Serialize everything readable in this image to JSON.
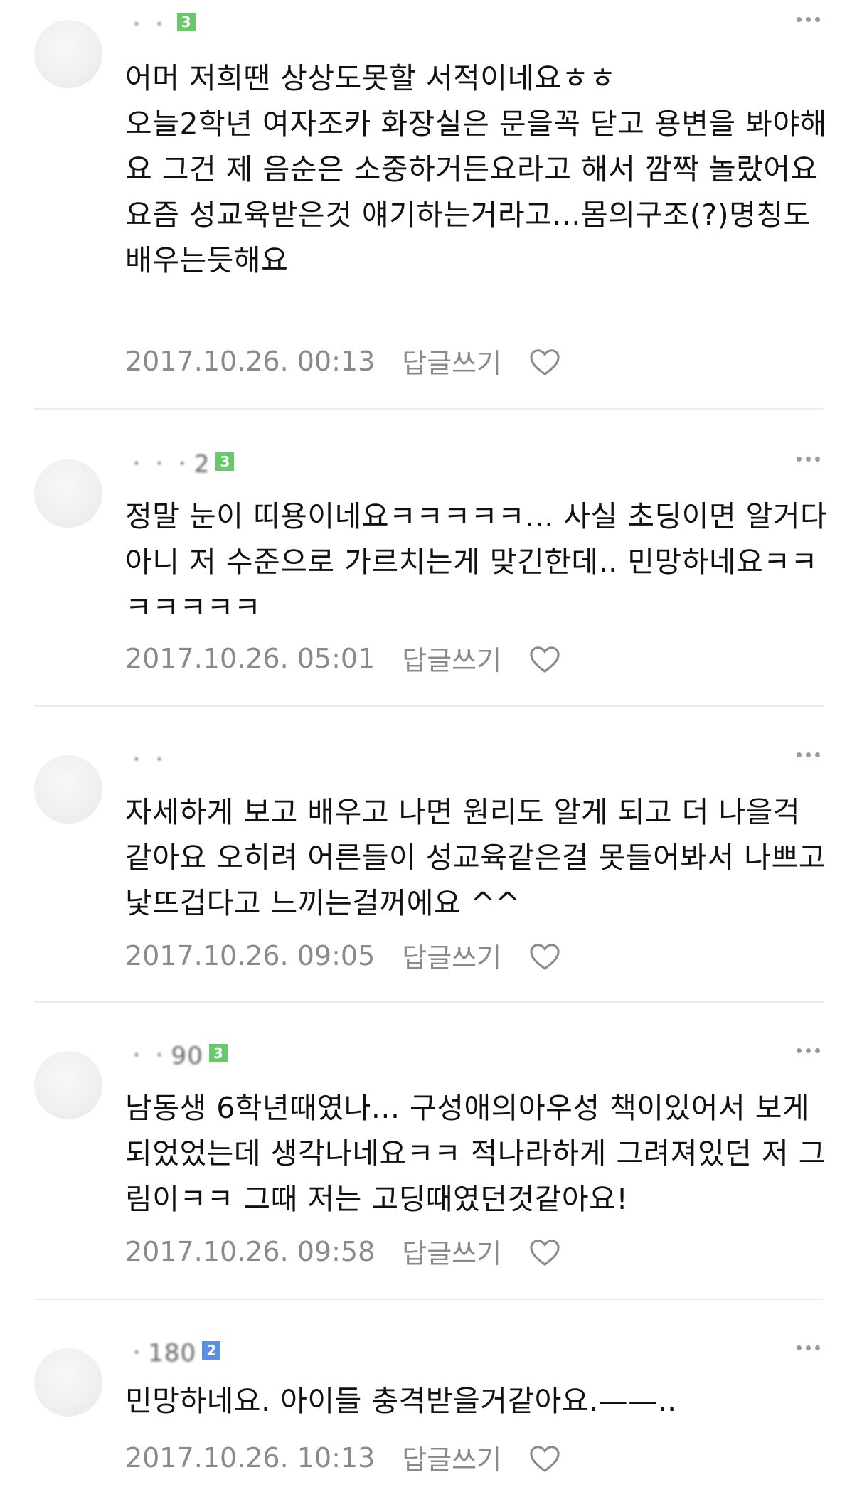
{
  "comments": [
    {
      "nickname": "ㆍㆍ",
      "level": "3",
      "text": "어머 저희땐 상상도못할 서적이네요ㅎㅎ\n오늘2학년 여자조카 화장실은 문을꼭 닫고 용변을 봐야해요 그건 제 음순은 소중하거든요라고 해서 깜짝 놀랐어요\n요즘 성교육받은것 얘기하는거라고...몸의구조(?)명칭도 배우는듯해요",
      "date": "2017.10.26. 00:13",
      "reply": "답글쓰기"
    },
    {
      "nickname": "ㆍㆍㆍ2",
      "level": "3",
      "text": "정말 눈이 띠용이네요ㅋㅋㅋㅋㅋ... 사실 초딩이면 알거다 아니 저 수준으로 가르치는게 맞긴한데.. 민망하네요ㅋㅋㅋㅋㅋㅋㅋ",
      "date": "2017.10.26. 05:01",
      "reply": "답글쓰기"
    },
    {
      "nickname": "ㆍㆍ",
      "level": "",
      "text": "자세하게 보고 배우고 나면 원리도 알게 되고 더 나을걱 같아요 오히려 어른들이 성교육같은걸 못들어봐서 나쁘고 낯뜨겁다고 느끼는걸꺼에요 ^^",
      "date": "2017.10.26. 09:05",
      "reply": "답글쓰기"
    },
    {
      "nickname": "ㆍㆍ90",
      "level": "3",
      "text": "남동생 6학년때였나... 구성애의아우성 책이있어서 보게되었었는데 생각나네요ㅋㅋ 적나라하게 그려져있던 저 그림이ㅋㅋ 그때 저는 고딩때였던것같아요!",
      "date": "2017.10.26. 09:58",
      "reply": "답글쓰기"
    },
    {
      "nickname": "ㆍ180",
      "level": "2",
      "text": "민망하네요. 아이들 충격받을거같아요.——..",
      "date": "2017.10.26. 10:13",
      "reply": "답글쓰기"
    }
  ],
  "icons": {
    "more": "more-dots-icon",
    "like": "heart-icon"
  },
  "colors": {
    "level_green": "#68c96a",
    "level_blue": "#5b8fe3",
    "meta_gray": "#8a8a8a"
  }
}
